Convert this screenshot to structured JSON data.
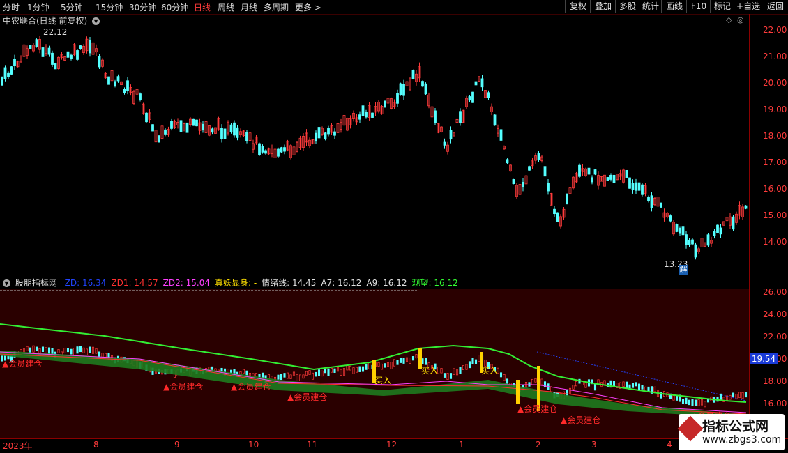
{
  "toolbar": {
    "periods": [
      "分时",
      "1分钟",
      "5分钟",
      "15分钟",
      "30分钟",
      "60分钟",
      "日线",
      "周线",
      "月线",
      "多周期",
      "更多 >"
    ],
    "active": "日线",
    "right_buttons": [
      "复权",
      "叠加",
      "多股",
      "统计",
      "画线",
      "F10",
      "标记",
      "+自选",
      "返回"
    ]
  },
  "main_panel": {
    "title": "中农联合(日线 前复权)",
    "high_label": "22.12",
    "low_label": "13.23",
    "badge": "解",
    "y_ticks": [
      "22.00",
      "21.00",
      "20.00",
      "19.00",
      "18.00",
      "17.00",
      "16.00",
      "15.00",
      "14.00"
    ]
  },
  "indicator_panel": {
    "name": "股朋指标网",
    "values": [
      {
        "label": "ZD",
        "text": "ZD: 16.34",
        "color": "#2244ff"
      },
      {
        "label": "ZD1",
        "text": "ZD1: 14.57",
        "color": "#ff3030"
      },
      {
        "label": "ZD2",
        "text": "ZD2: 15.04",
        "color": "#ff40ff"
      },
      {
        "label": "真妖显身",
        "text": "真妖显身: -",
        "color": "#ffe000"
      },
      {
        "label": "情绪线",
        "text": "情绪线: 14.45",
        "color": "#e0e0e0"
      },
      {
        "label": "A7",
        "text": "A7: 16.12",
        "color": "#e0e0e0"
      },
      {
        "label": "A9",
        "text": "A9: 16.12",
        "color": "#e0e0e0"
      },
      {
        "label": "观望",
        "text": "观望: 16.12",
        "color": "#33ff33"
      }
    ],
    "y_ticks": [
      "26.00",
      "24.00",
      "22.00",
      "20.00",
      "18.00",
      "16.00"
    ],
    "current_price": "19.54",
    "signals": {
      "build": "会员建仓",
      "buy": "买入",
      "tail": "会员建仓"
    }
  },
  "x_axis": [
    "2023年",
    "8",
    "9",
    "10",
    "11",
    "12",
    "1",
    "2",
    "3",
    "4"
  ],
  "watermark": {
    "title": "指标公式网",
    "url": "www.zbgs3.com"
  },
  "colors": {
    "up": "#ff3b3b",
    "down": "#54ffff",
    "frame": "#8b0000",
    "green": "#33ee33"
  }
}
